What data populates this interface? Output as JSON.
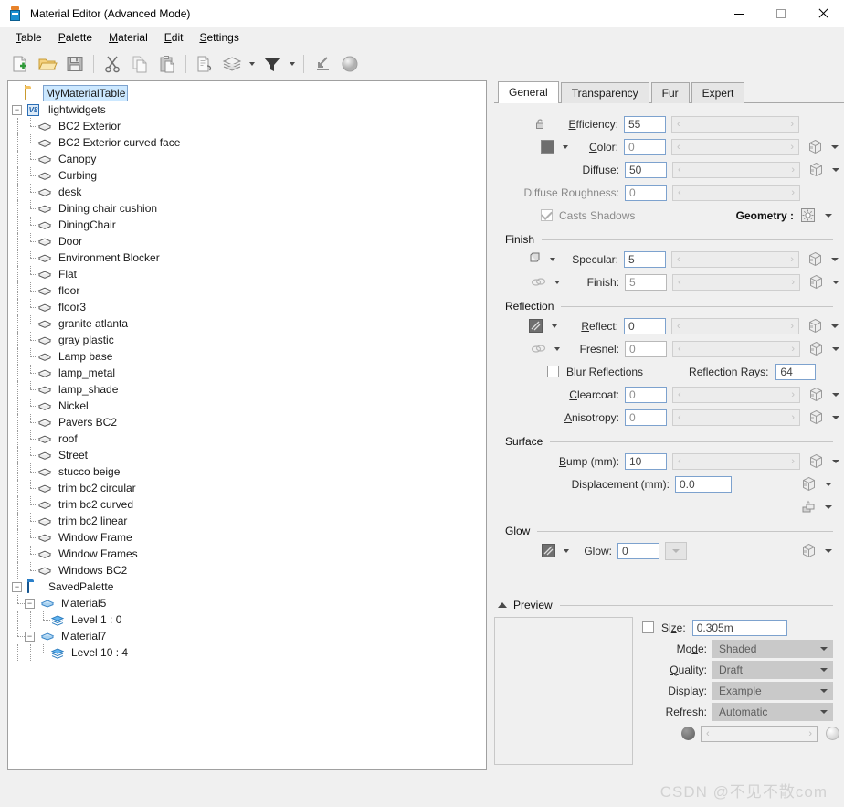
{
  "window": {
    "title": "Material Editor (Advanced Mode)",
    "icon": "material-editor-icon",
    "minimize": "–",
    "maximize": "□",
    "close": "✕"
  },
  "menubar": {
    "items": [
      {
        "label": "Table",
        "accel": "T"
      },
      {
        "label": "Palette",
        "accel": "P"
      },
      {
        "label": "Material",
        "accel": "M"
      },
      {
        "label": "Edit",
        "accel": "E"
      },
      {
        "label": "Settings",
        "accel": "S"
      }
    ]
  },
  "toolbar": {
    "buttons": [
      {
        "name": "new-table-icon",
        "tip": "New"
      },
      {
        "name": "open-folder-icon",
        "tip": "Open"
      },
      {
        "name": "save-icon",
        "tip": "Save"
      },
      {
        "name": "cut-icon",
        "tip": "Cut"
      },
      {
        "name": "copy-icon",
        "tip": "Copy"
      },
      {
        "name": "paste-icon",
        "tip": "Paste"
      },
      {
        "name": "reload-document-icon",
        "tip": "Reload"
      },
      {
        "name": "layers-icon",
        "tip": "Layers"
      },
      {
        "name": "filter-icon",
        "tip": "Filter"
      },
      {
        "name": "import-icon",
        "tip": "Import"
      },
      {
        "name": "sphere-preview-icon",
        "tip": "Preview Sphere"
      }
    ]
  },
  "tree": {
    "nodes": [
      {
        "label": "MyMaterialTable",
        "icon": "folder-icon",
        "depth": 0,
        "expander": "",
        "selected": true
      },
      {
        "label": "lightwidgets",
        "icon": "v8-icon",
        "depth": 0,
        "expander": "−",
        "selected": false
      },
      {
        "label": "BC2 Exterior",
        "icon": "material-icon",
        "depth": 2,
        "expander": "",
        "selected": false
      },
      {
        "label": "BC2 Exterior curved face",
        "icon": "material-icon",
        "depth": 2,
        "expander": "",
        "selected": false
      },
      {
        "label": "Canopy",
        "icon": "material-icon",
        "depth": 2,
        "expander": "",
        "selected": false
      },
      {
        "label": "Curbing",
        "icon": "material-icon",
        "depth": 2,
        "expander": "",
        "selected": false
      },
      {
        "label": "desk",
        "icon": "material-icon",
        "depth": 2,
        "expander": "",
        "selected": false
      },
      {
        "label": "Dining chair cushion",
        "icon": "material-icon",
        "depth": 2,
        "expander": "",
        "selected": false
      },
      {
        "label": "DiningChair",
        "icon": "material-icon",
        "depth": 2,
        "expander": "",
        "selected": false
      },
      {
        "label": "Door",
        "icon": "material-icon",
        "depth": 2,
        "expander": "",
        "selected": false
      },
      {
        "label": "Environment Blocker",
        "icon": "material-icon",
        "depth": 2,
        "expander": "",
        "selected": false
      },
      {
        "label": "Flat",
        "icon": "material-icon",
        "depth": 2,
        "expander": "",
        "selected": false
      },
      {
        "label": "floor",
        "icon": "material-icon",
        "depth": 2,
        "expander": "",
        "selected": false
      },
      {
        "label": "floor3",
        "icon": "material-icon",
        "depth": 2,
        "expander": "",
        "selected": false
      },
      {
        "label": "granite atlanta",
        "icon": "material-icon",
        "depth": 2,
        "expander": "",
        "selected": false
      },
      {
        "label": "gray plastic",
        "icon": "material-icon",
        "depth": 2,
        "expander": "",
        "selected": false
      },
      {
        "label": "Lamp base",
        "icon": "material-icon",
        "depth": 2,
        "expander": "",
        "selected": false
      },
      {
        "label": "lamp_metal",
        "icon": "material-icon",
        "depth": 2,
        "expander": "",
        "selected": false
      },
      {
        "label": "lamp_shade",
        "icon": "material-icon",
        "depth": 2,
        "expander": "",
        "selected": false
      },
      {
        "label": "Nickel",
        "icon": "material-icon",
        "depth": 2,
        "expander": "",
        "selected": false
      },
      {
        "label": "Pavers BC2",
        "icon": "material-icon",
        "depth": 2,
        "expander": "",
        "selected": false
      },
      {
        "label": "roof",
        "icon": "material-icon",
        "depth": 2,
        "expander": "",
        "selected": false
      },
      {
        "label": "Street",
        "icon": "material-icon",
        "depth": 2,
        "expander": "",
        "selected": false
      },
      {
        "label": "stucco beige",
        "icon": "material-icon",
        "depth": 2,
        "expander": "",
        "selected": false
      },
      {
        "label": "trim bc2 circular",
        "icon": "material-icon",
        "depth": 2,
        "expander": "",
        "selected": false
      },
      {
        "label": "trim bc2 curved",
        "icon": "material-icon",
        "depth": 2,
        "expander": "",
        "selected": false
      },
      {
        "label": "trim bc2 linear",
        "icon": "material-icon",
        "depth": 2,
        "expander": "",
        "selected": false
      },
      {
        "label": "Window Frame",
        "icon": "material-icon",
        "depth": 2,
        "expander": "",
        "selected": false
      },
      {
        "label": "Window Frames",
        "icon": "material-icon",
        "depth": 2,
        "expander": "",
        "selected": false
      },
      {
        "label": "Windows BC2",
        "icon": "material-icon",
        "depth": 2,
        "expander": "",
        "selected": false
      },
      {
        "label": "SavedPalette",
        "icon": "folder-blue-icon",
        "depth": 0,
        "expander": "−",
        "selected": false
      },
      {
        "label": "Material5",
        "icon": "material-blue-icon",
        "depth": 1,
        "expander": "−",
        "selected": false
      },
      {
        "label": "Level 1 : 0",
        "icon": "level-icon",
        "depth": 3,
        "expander": "",
        "selected": false
      },
      {
        "label": "Material7",
        "icon": "material-blue-icon",
        "depth": 1,
        "expander": "−",
        "selected": false
      },
      {
        "label": "Level 10 : 4",
        "icon": "level-icon",
        "depth": 3,
        "expander": "",
        "selected": false
      }
    ]
  },
  "tabs": [
    {
      "label": "General",
      "active": true
    },
    {
      "label": "Transparency",
      "active": false
    },
    {
      "label": "Fur",
      "active": false
    },
    {
      "label": "Expert",
      "active": false
    }
  ],
  "general": {
    "efficiency": {
      "label": "Efficiency:",
      "accel": "E",
      "value": "55",
      "icon": "unlock-icon"
    },
    "color": {
      "label": "Color:",
      "accel": "C",
      "value": "0",
      "swatch": "#6e6e6e",
      "icon": "color-swatch"
    },
    "diffuse": {
      "label": "Diffuse:",
      "accel": "D",
      "value": "50"
    },
    "diffuse_roughness": {
      "label": "Diffuse Roughness:",
      "value": "0"
    },
    "casts_shadows": {
      "label": "Casts Shadows",
      "checked": true
    },
    "geometry": {
      "label": "Geometry :",
      "icon": "geometry-icon"
    }
  },
  "finish": {
    "title": "Finish",
    "specular": {
      "label": "Specular:",
      "value": "5",
      "icon": "cube-icon"
    },
    "finish": {
      "label": "Finish:",
      "value": "5",
      "icon": "chain-icon"
    }
  },
  "reflection": {
    "title": "Reflection",
    "reflect": {
      "label": "Reflect:",
      "accel": "R",
      "value": "0",
      "icon": "hatch-swatch-icon"
    },
    "fresnel": {
      "label": "Fresnel:",
      "value": "0",
      "icon": "chain-icon"
    },
    "blur_reflections": {
      "label": "Blur Reflections",
      "checked": false
    },
    "reflection_rays": {
      "label": "Reflection Rays:",
      "value": "64"
    },
    "clearcoat": {
      "label": "Clearcoat:",
      "accel": "C",
      "value": "0"
    },
    "anisotropy": {
      "label": "Anisotropy:",
      "accel": "A",
      "value": "0"
    }
  },
  "surface": {
    "title": "Surface",
    "bump": {
      "label": "Bump (mm):",
      "accel": "B",
      "value": "10"
    },
    "displacement": {
      "label": "Displacement (mm):",
      "value": "0.0"
    }
  },
  "glow": {
    "title": "Glow",
    "glow": {
      "label": "Glow:",
      "value": "0",
      "icon": "hatch-swatch-icon"
    }
  },
  "preview": {
    "title": "Preview",
    "collapse_icon": "triangle-up-icon",
    "size": {
      "label": "Size:",
      "accel": "z",
      "value": "0.305m",
      "checked": false
    },
    "mode": {
      "label": "Mode:",
      "accel": "d",
      "value": "Shaded"
    },
    "quality": {
      "label": "Quality:",
      "accel": "Q",
      "value": "Draft"
    },
    "display": {
      "label": "Display:",
      "accel": "l",
      "value": "Example"
    },
    "refresh": {
      "label": "Refresh:",
      "value": "Automatic"
    },
    "left_sphere_icon": "dark-sphere-icon",
    "right_sphere_icon": "light-sphere-icon"
  },
  "slider": {
    "left": "‹",
    "right": "›"
  },
  "watermark": "CSDN @不见不散com"
}
